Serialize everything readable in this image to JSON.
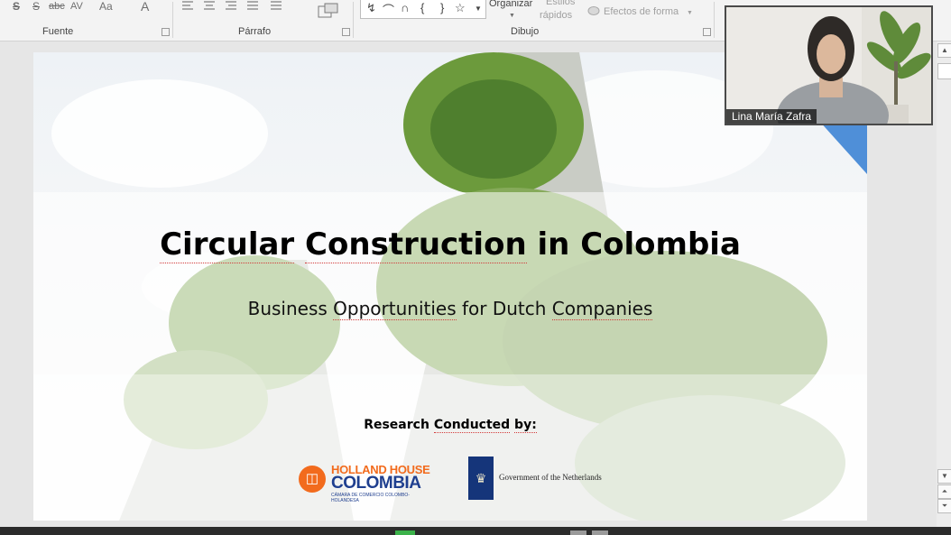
{
  "ribbon": {
    "font_tools": {
      "shadow": "S",
      "strike": "abc",
      "spacing": "AV",
      "case": "Aa",
      "color": "A"
    },
    "group_labels": {
      "font": "Fuente",
      "paragraph": "Párrafo",
      "drawing": "Dibujo"
    },
    "drawing": {
      "arrange": "Organizar",
      "quick_styles_line1": "Estilos",
      "quick_styles_line2": "rápidos",
      "shape_effects": "Efectos de forma"
    },
    "shapes": [
      "↯",
      "⌒",
      "∩",
      "{",
      "}",
      "☆"
    ]
  },
  "slide": {
    "title_word1": "Circular",
    "title_word2": "Construction",
    "title_rest": "in Colombia",
    "subtitle_word1": "Business",
    "subtitle_word2": "Opportunities",
    "subtitle_mid": "for Dutch",
    "subtitle_word3": "Companies",
    "research_word1": "Research",
    "research_word2": "Conducted",
    "research_word3": "by:",
    "logo_hh": {
      "line1": "HOLLAND HOUSE",
      "line2": "COLOMBIA",
      "line3": "CÁMARA DE COMERCIO COLOMBO-HOLANDESA",
      "color_orange": "#f26b1d",
      "color_blue": "#1f3f8f"
    },
    "logo_nl": {
      "text": "Government of the Netherlands",
      "color": "#15357a"
    }
  },
  "video": {
    "participant_name": "Lina María Zafra"
  }
}
